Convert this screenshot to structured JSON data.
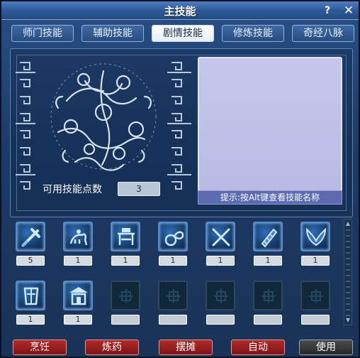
{
  "window": {
    "title": "主技能",
    "help_label": "?",
    "close_label": "✕"
  },
  "tabs": [
    {
      "label": "师门技能",
      "active": false
    },
    {
      "label": "辅助技能",
      "active": false
    },
    {
      "label": "剧情技能",
      "active": true
    },
    {
      "label": "修炼技能",
      "active": false
    },
    {
      "label": "奇经八脉",
      "active": false
    }
  ],
  "points": {
    "label": "可用技能点数",
    "value": "3"
  },
  "hint": "提示:按Alt键查看技能名称",
  "skills_row1": [
    {
      "icon": "hammer-skill-icon",
      "level": "5"
    },
    {
      "icon": "mounted-rider-skill-icon",
      "level": "1"
    },
    {
      "icon": "crafting-table-skill-icon",
      "level": "1"
    },
    {
      "icon": "rope-loop-skill-icon",
      "level": "1"
    },
    {
      "icon": "crossed-blades-skill-icon",
      "level": "1"
    },
    {
      "icon": "whetstone-skill-icon",
      "level": "1"
    },
    {
      "icon": "wings-skill-icon",
      "level": "1"
    }
  ],
  "skills_row2": [
    {
      "icon": "armor-skill-icon",
      "level": "1"
    },
    {
      "icon": "shrine-skill-icon",
      "level": "1"
    },
    {
      "icon": "empty-slot-icon",
      "level": ""
    },
    {
      "icon": "empty-slot-icon",
      "level": ""
    },
    {
      "icon": "empty-slot-icon",
      "level": ""
    },
    {
      "icon": "empty-slot-icon",
      "level": ""
    },
    {
      "icon": "empty-slot-icon",
      "level": ""
    }
  ],
  "buttons": {
    "cook": "烹饪",
    "alchemy": "炼药",
    "stall": "摆摊",
    "auto": "自动",
    "use": "使用"
  },
  "colors": {
    "accent": "#2a4f86",
    "action_red": "#a52222",
    "panel_lavender": "#c6c6ec"
  }
}
